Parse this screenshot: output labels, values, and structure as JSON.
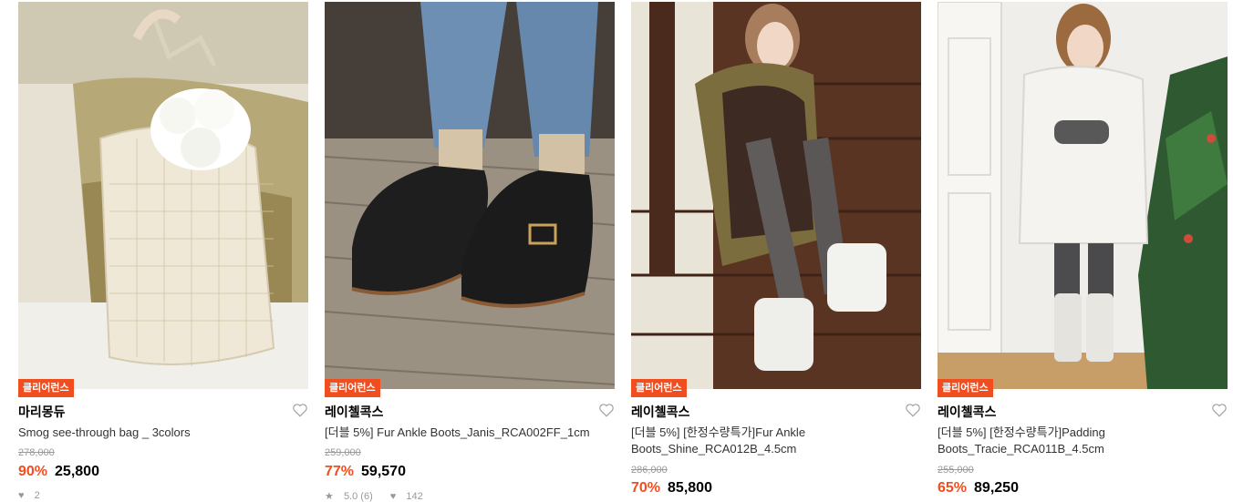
{
  "products": [
    {
      "badge": "클리어런스",
      "brand": "마리몽듀",
      "title": "Smog see-through bag _ 3colors",
      "original_price": "278,000",
      "discount": "90%",
      "price": "25,800",
      "likes": "2"
    },
    {
      "badge": "클리어런스",
      "brand": "레이첼콕스",
      "title": "[더블 5%] Fur Ankle Boots_Janis_RCA002FF_1cm",
      "original_price": "259,000",
      "discount": "77%",
      "price": "59,570",
      "rating": "5.0 (6)",
      "likes": "142"
    },
    {
      "badge": "클리어런스",
      "brand": "레이첼콕스",
      "title": "[더블 5%] [한정수량특가]Fur Ankle Boots_Shine_RCA012B_4.5cm",
      "original_price": "286,000",
      "discount": "70%",
      "price": "85,800"
    },
    {
      "badge": "클리어런스",
      "brand": "레이첼콕스",
      "title": "[더블 5%] [한정수량특가]Padding Boots_Tracie_RCA011B_4.5cm",
      "original_price": "255,000",
      "discount": "65%",
      "price": "89,250"
    }
  ],
  "colors": {
    "accent": "#f04e1f",
    "strike": "#9a9a9a"
  }
}
